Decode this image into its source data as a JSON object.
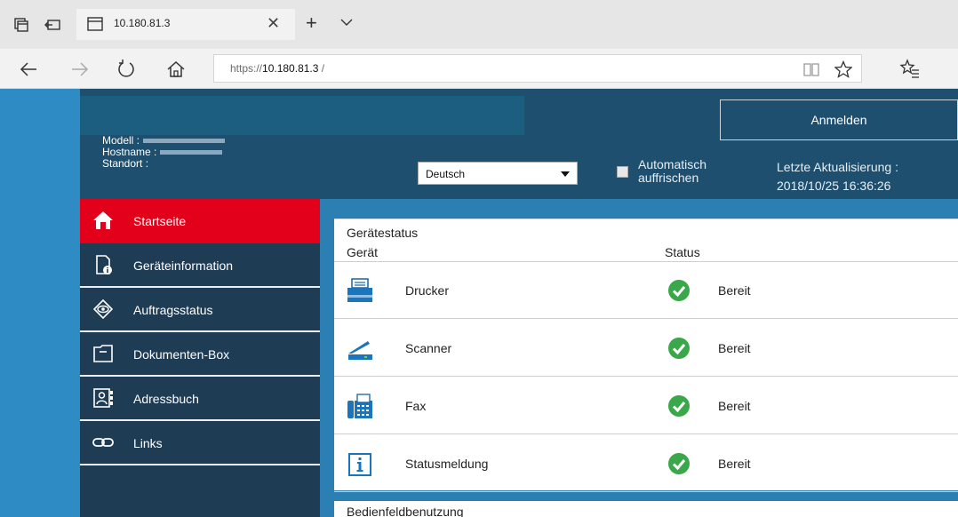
{
  "browser": {
    "tab_title": "10.180.81.3",
    "close_symbol": "✕",
    "new_tab_symbol": "+",
    "url_prefix": "https://",
    "url_host": "10.180.81.3",
    "url_suffix": " /"
  },
  "header": {
    "model_label": "Modell :",
    "hostname_label": "Hostname :",
    "location_label": "Standort :",
    "language": "Deutsch",
    "auto_refresh_line1": "Automatisch",
    "auto_refresh_line2": "auffrischen",
    "last_update_label": "Letzte Aktualisierung :",
    "last_update_value": "2018/10/25 16:36:26",
    "login_label": "Anmelden"
  },
  "sidebar": {
    "items": [
      {
        "label": "Startseite",
        "icon": "home-icon",
        "active": true
      },
      {
        "label": "Geräteinformation",
        "icon": "device-info-icon"
      },
      {
        "label": "Auftragsstatus",
        "icon": "eye-icon"
      },
      {
        "label": "Dokumenten-Box",
        "icon": "document-box-icon"
      },
      {
        "label": "Adressbuch",
        "icon": "address-book-icon"
      },
      {
        "label": "Links",
        "icon": "link-icon"
      }
    ]
  },
  "device_status": {
    "title": "Gerätestatus",
    "col_device": "Gerät",
    "col_status": "Status",
    "rows": [
      {
        "device": "Drucker",
        "icon": "printer-icon",
        "status": "Bereit"
      },
      {
        "device": "Scanner",
        "icon": "scanner-icon",
        "status": "Bereit"
      },
      {
        "device": "Fax",
        "icon": "fax-icon",
        "status": "Bereit"
      },
      {
        "device": "Statusmeldung",
        "icon": "info-icon",
        "status": "Bereit"
      }
    ]
  },
  "panel_usage": {
    "title": "Bedienfeldbenutzung"
  },
  "colors": {
    "accent_red": "#e2001a",
    "sidebar_bg": "#1f3c55",
    "status_ok": "#3aa84a",
    "page_blue": "#2c7fb3"
  }
}
